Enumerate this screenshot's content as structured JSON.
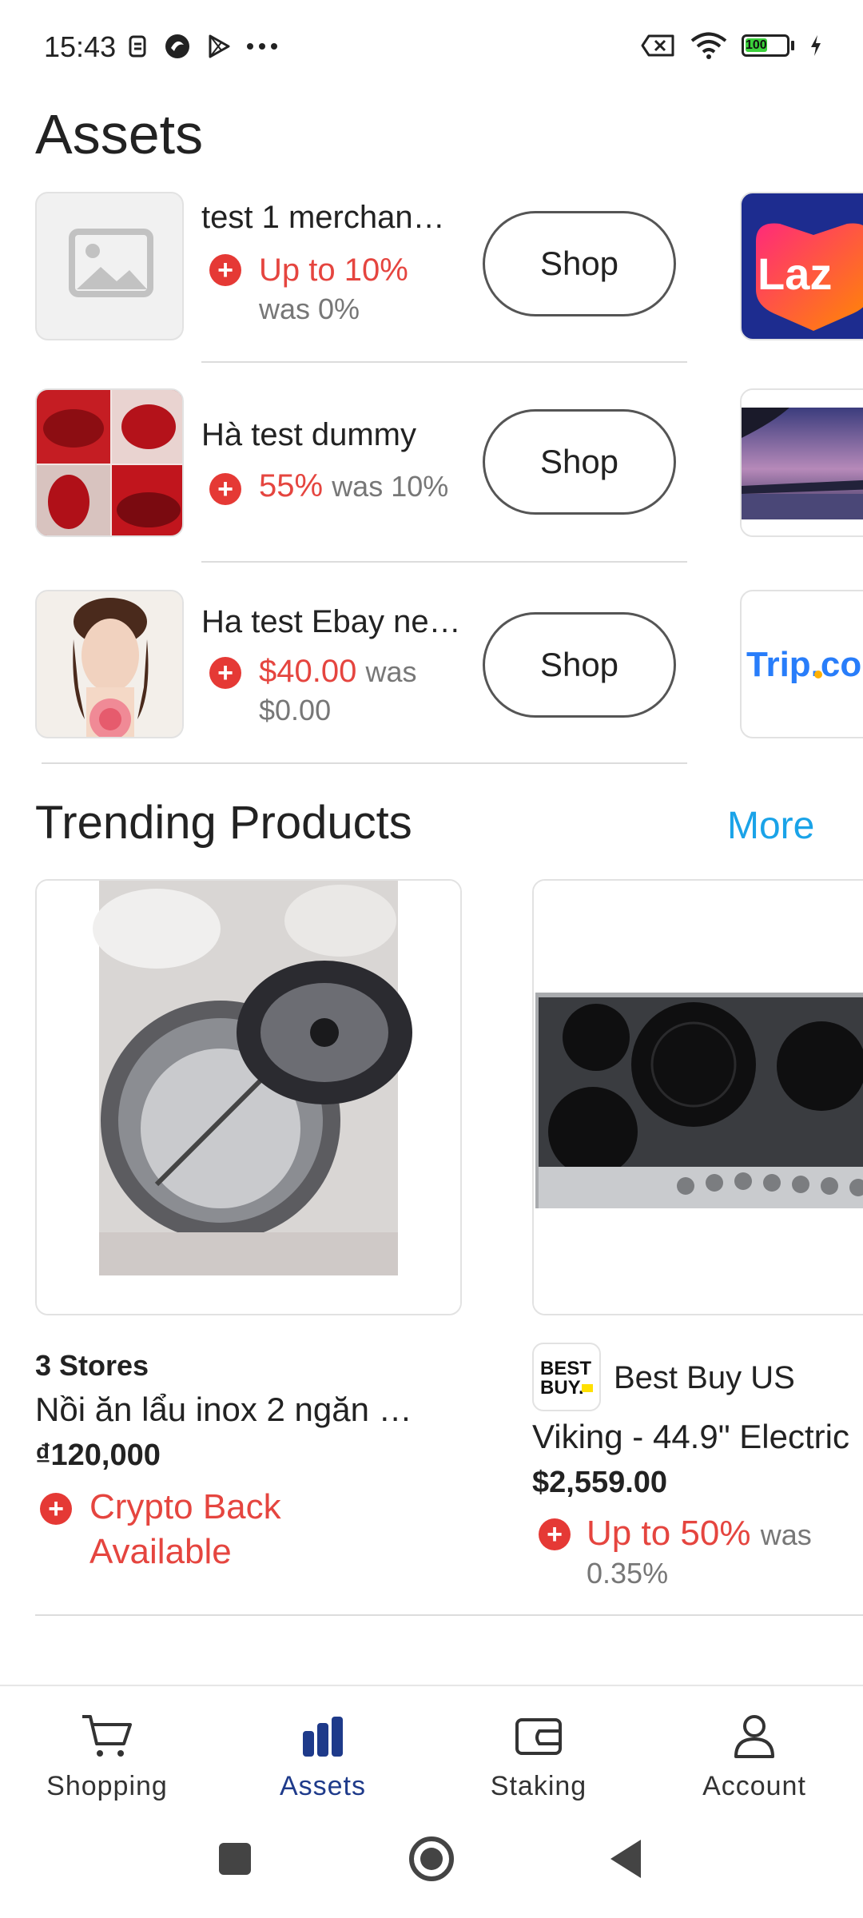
{
  "status_bar": {
    "time": "15:43",
    "battery": "100"
  },
  "page": {
    "title": "Assets"
  },
  "merchants": [
    {
      "name": "test 1 merchan…",
      "reward": "Up to 10%",
      "was_line": "was 0%",
      "button": "Shop",
      "thumbnail": "image-placeholder-icon"
    },
    {
      "name": "Hà test dummy",
      "reward": "55%",
      "was_inline": "was 10%",
      "button": "Shop",
      "thumbnail": "lipstick-photo"
    },
    {
      "name": "Ha test Ebay ne…",
      "reward": "$40.00",
      "was_inline": "was",
      "was_line": "$0.00",
      "button": "Shop",
      "thumbnail": "portrait-photo"
    }
  ],
  "side_cards": [
    {
      "label": "Laz",
      "brand_color": "#ff6a00"
    },
    {
      "label": "",
      "image": "lake-sunset-photo"
    },
    {
      "label": "Trip.con",
      "brand_color": "#287dfa"
    }
  ],
  "trending": {
    "title": "Trending Products",
    "more": "More",
    "products": [
      {
        "stores": "3 Stores",
        "name": "Nồi ăn lẩu inox 2 ngăn …",
        "price": "₫120,000",
        "cashback_line1": "Crypto Back",
        "cashback_line2": "Available"
      },
      {
        "store_name": "Best Buy US",
        "store_logo": "BEST BUY",
        "name": "Viking - 44.9\" Electric",
        "price": "$2,559.00",
        "reward": "Up to 50%",
        "was_inline": "was",
        "was_line": "0.35%"
      }
    ]
  },
  "bottom_nav": {
    "items": [
      {
        "label": "Shopping",
        "icon": "cart-icon"
      },
      {
        "label": "Assets",
        "icon": "bar-chart-icon",
        "active": true
      },
      {
        "label": "Staking",
        "icon": "wallet-icon"
      },
      {
        "label": "Account",
        "icon": "person-icon"
      }
    ]
  },
  "colors": {
    "accent_red": "#e5453f",
    "link_blue": "#1aa3e8",
    "active_nav": "#1e3a8a"
  }
}
